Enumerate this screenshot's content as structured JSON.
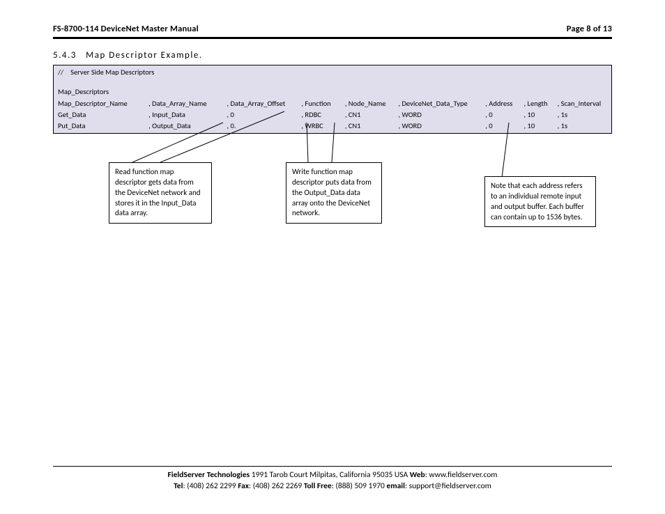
{
  "header": {
    "title": "FS-8700-114 DeviceNet Master Manual",
    "page": "Page 8 of 13"
  },
  "section": {
    "number": "5.4.3",
    "title": "Map Descriptor Example."
  },
  "table": {
    "comment_marker": "//",
    "comment_text": "Server Side Map Descriptors",
    "block_label": "Map_Descriptors",
    "header": {
      "c0": "Map_Descriptor_Name",
      "c1": ", Data_Array_Name",
      "c2": ", Data_Array_Offset",
      "c3": ", Function",
      "c4": ", Node_Name",
      "c5": ", DeviceNet_Data_Type",
      "c6": ", Address",
      "c7": ", Length",
      "c8": ", Scan_Interval"
    },
    "row1": {
      "c0": "Get_Data",
      "c1": ", Input_Data",
      "c2": ", 0",
      "c3": ", RDBC",
      "c4": ", CN1",
      "c5": ", WORD",
      "c6": ", 0",
      "c7": ", 10",
      "c8": ", 1s"
    },
    "row2": {
      "c0": "Put_Data",
      "c1": ", Output_Data",
      "c2": ", 0.",
      "c3": ", WRBC",
      "c4": ", CN1",
      "c5": ", WORD",
      "c6": ", 0",
      "c7": ", 10",
      "c8": ", 1s"
    }
  },
  "callouts": {
    "read": "Read function map descriptor gets data from the DeviceNet network and stores it in the Input_Data data array.",
    "write": "Write function map descriptor puts data from the Output_Data data array onto the DeviceNet network.",
    "address": "Note that each address refers to an individual remote input and output buffer. Each buffer can contain up to 1536 bytes."
  },
  "footer": {
    "company": "FieldServer Technologies",
    "address": " 1991 Tarob Court Milpitas, California 95035 USA  ",
    "web_label": "Web",
    "web": ": www.fieldserver.com",
    "tel_label": "Tel",
    "tel": ": (408) 262 2299  ",
    "fax_label": "Fax",
    "fax": ": (408) 262 2269  ",
    "tollfree_label": "Toll Free",
    "tollfree": ": (888) 509 1970  ",
    "email_label": "email",
    "email": ": support@fieldserver.com"
  }
}
